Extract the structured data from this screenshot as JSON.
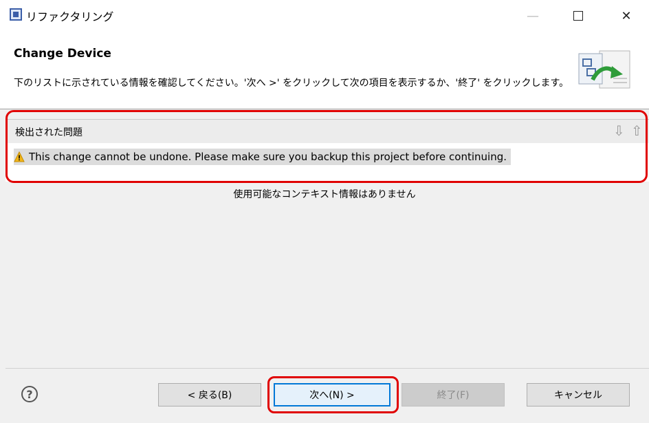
{
  "window": {
    "title": "リファクタリング",
    "icons": {
      "app": "app-icon",
      "minimize": "minimize-icon",
      "maximize": "maximize-icon",
      "close": "close-icon"
    }
  },
  "header": {
    "title": "Change Device",
    "description": "下のリストに示されている情報を確認してください。'次へ >' をクリックして次の項目を表示するか、'終了' をクリックします。",
    "image_icon": "refactoring-wizard-icon"
  },
  "problems": {
    "title": "検出された問題",
    "nav_icons": [
      "arrow-down-icon",
      "arrow-up-icon"
    ],
    "items": [
      {
        "icon": "warning-icon",
        "text": "This change cannot be undone. Please make sure you backup this project before continuing."
      }
    ]
  },
  "context": {
    "message": "使用可能なコンテキスト情報はありません"
  },
  "footer": {
    "help_icon": "help-icon",
    "back_label": "< 戻る(B)",
    "next_label": "次へ(N) >",
    "finish_label": "終了(F)",
    "cancel_label": "キャンセル"
  },
  "colors": {
    "highlight": "#e00000",
    "focus": "#0078d7",
    "warning": "#f2b619"
  }
}
